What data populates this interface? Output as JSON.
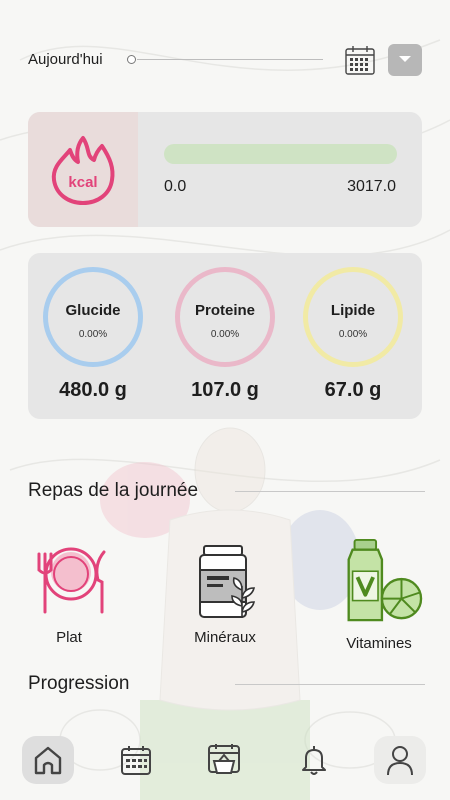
{
  "header": {
    "date_label": "Aujourd'hui",
    "calendar_icon": "calendar-icon",
    "dropdown_icon": "chevron-down-icon"
  },
  "calories": {
    "icon": "kcal-flame-icon",
    "icon_text": "kcal",
    "current": "0.0",
    "target": "3017.0",
    "progress_fraction": 0.0,
    "bar_color": "#cfe3c4",
    "accent": "#e2437a"
  },
  "macros": [
    {
      "name": "Glucide",
      "percent": "0.00%",
      "amount": "480.0 g",
      "ring_color": "#a9cdee"
    },
    {
      "name": "Proteine",
      "percent": "0.00%",
      "amount": "107.0 g",
      "ring_color": "#eab8c9"
    },
    {
      "name": "Lipide",
      "percent": "0.00%",
      "amount": "67.0 g",
      "ring_color": "#f1eaa5"
    }
  ],
  "meals": {
    "title": "Repas de la journée",
    "items": [
      {
        "label": "Plat",
        "icon": "plate-utensils-icon"
      },
      {
        "label": "Minéraux",
        "icon": "supplement-jar-icon"
      },
      {
        "label": "Vitamines",
        "icon": "vitamin-bottle-icon"
      }
    ]
  },
  "progression": {
    "title": "Progression"
  },
  "nav": [
    {
      "icon": "home-icon",
      "active": true
    },
    {
      "icon": "calendar-icon",
      "active": false
    },
    {
      "icon": "food-basket-icon",
      "active": false
    },
    {
      "icon": "bell-icon",
      "active": false
    },
    {
      "icon": "profile-icon",
      "active": false
    }
  ]
}
